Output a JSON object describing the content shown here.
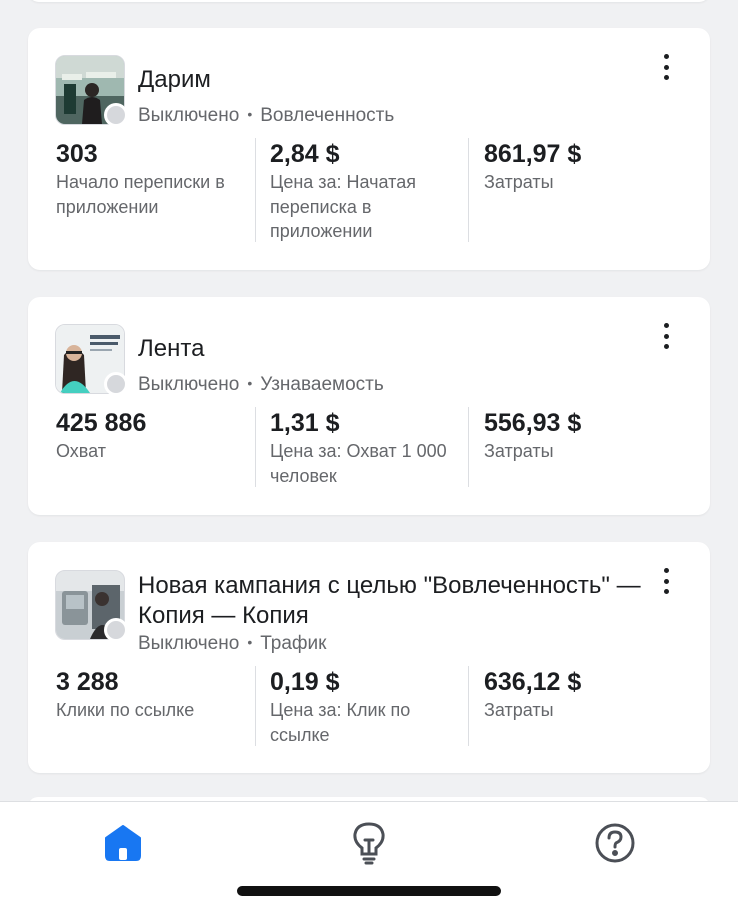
{
  "campaigns": [
    {
      "name": "Дарим",
      "status": "Выключено",
      "objective": "Вовлеченность",
      "metrics": [
        {
          "value": "303",
          "label": "Начало переписки в приложении"
        },
        {
          "value": "2,84 $",
          "label": "Цена за: Начатая переписка в приложении"
        },
        {
          "value": "861,97 $",
          "label": "Затраты"
        }
      ]
    },
    {
      "name": "Лента",
      "status": "Выключено",
      "objective": "Узнаваемость",
      "metrics": [
        {
          "value": "425 886",
          "label": "Охват"
        },
        {
          "value": "1,31 $",
          "label": "Цена за: Охват 1 000 человек"
        },
        {
          "value": "556,93 $",
          "label": "Затраты"
        }
      ]
    },
    {
      "name": "Новая кампания с целью \"Вовлеченность\" — Копия — Копия",
      "status": "Выключено",
      "objective": "Трафик",
      "metrics": [
        {
          "value": "3 288",
          "label": "Клики по ссылке"
        },
        {
          "value": "0,19 $",
          "label": "Цена за: Клик по ссылке"
        },
        {
          "value": "636,12 $",
          "label": "Затраты"
        }
      ]
    }
  ],
  "icons": {
    "more": "more-vertical-icon",
    "tabs": [
      "home-icon",
      "lightbulb-icon",
      "help-icon"
    ]
  },
  "colors": {
    "accent": "#1877f2",
    "status_off": "#d6d8dc",
    "secondary_text": "#65676b"
  }
}
